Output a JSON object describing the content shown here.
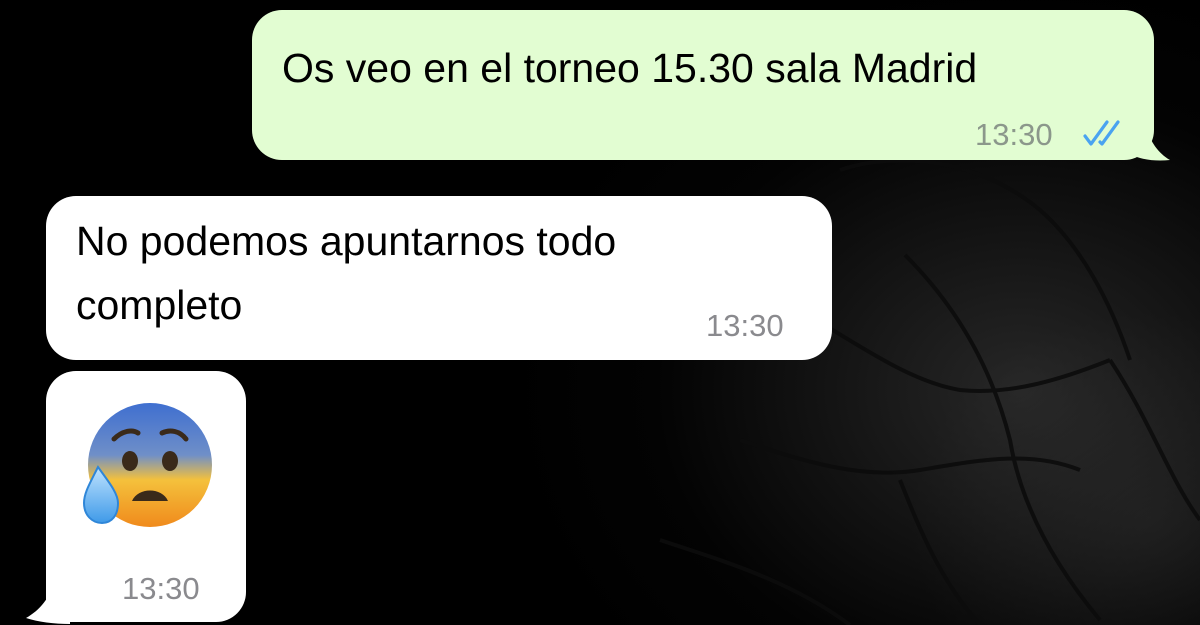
{
  "messages": [
    {
      "direction": "outgoing",
      "text": "Os veo en el torneo 15.30 sala Madrid",
      "time": "13:30",
      "status_icon": "double-check-read-icon",
      "bubble_color": "#e2fdd2",
      "tick_color": "#4aa3f0"
    },
    {
      "direction": "incoming",
      "lines": [
        "No podemos apuntarnos todo",
        "completo"
      ],
      "time": "13:30",
      "bubble_color": "#ffffff"
    },
    {
      "direction": "incoming",
      "emoji_icon": "anxious-face-with-sweat-icon",
      "emoji": "😰",
      "time": "13:30",
      "bubble_color": "#ffffff"
    }
  ]
}
